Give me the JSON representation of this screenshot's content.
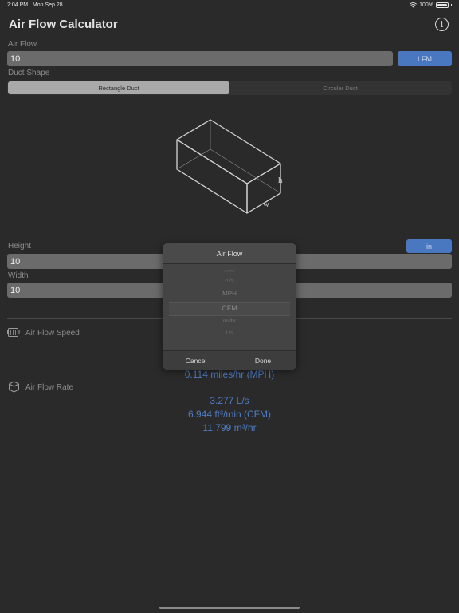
{
  "status": {
    "time": "2:04 PM",
    "date": "Mon Sep 28",
    "battery": "100%"
  },
  "app": {
    "title": "Air Flow Calculator",
    "info_icon": "info-icon"
  },
  "airflow": {
    "label": "Air Flow",
    "value": "10",
    "unit": "LFM"
  },
  "duct_shape": {
    "label": "Duct Shape",
    "options": [
      "Rectangle Duct",
      "Circular Duct"
    ],
    "selected": "Rectangle Duct"
  },
  "diagram": {
    "h_label": "h",
    "w_label": "w"
  },
  "height": {
    "label": "Height",
    "value": "10",
    "unit": "in"
  },
  "width": {
    "label": "Width",
    "value": "10"
  },
  "speed": {
    "title": "Air Flow Speed",
    "icon": "fan-icon",
    "mph": "0.114 miles/hr (MPH)"
  },
  "rate": {
    "title": "Air Flow Rate",
    "icon": "cube-icon",
    "values": [
      "3.277 L/s",
      "6.944 ft³/min (CFM)",
      "11.799 m³/hr"
    ]
  },
  "picker": {
    "title": "Air Flow",
    "options": [
      "LFM",
      "m/s",
      "MPH",
      "CFM",
      "m³/hr",
      "L/s"
    ],
    "selected": "CFM",
    "cancel": "Cancel",
    "done": "Done"
  }
}
